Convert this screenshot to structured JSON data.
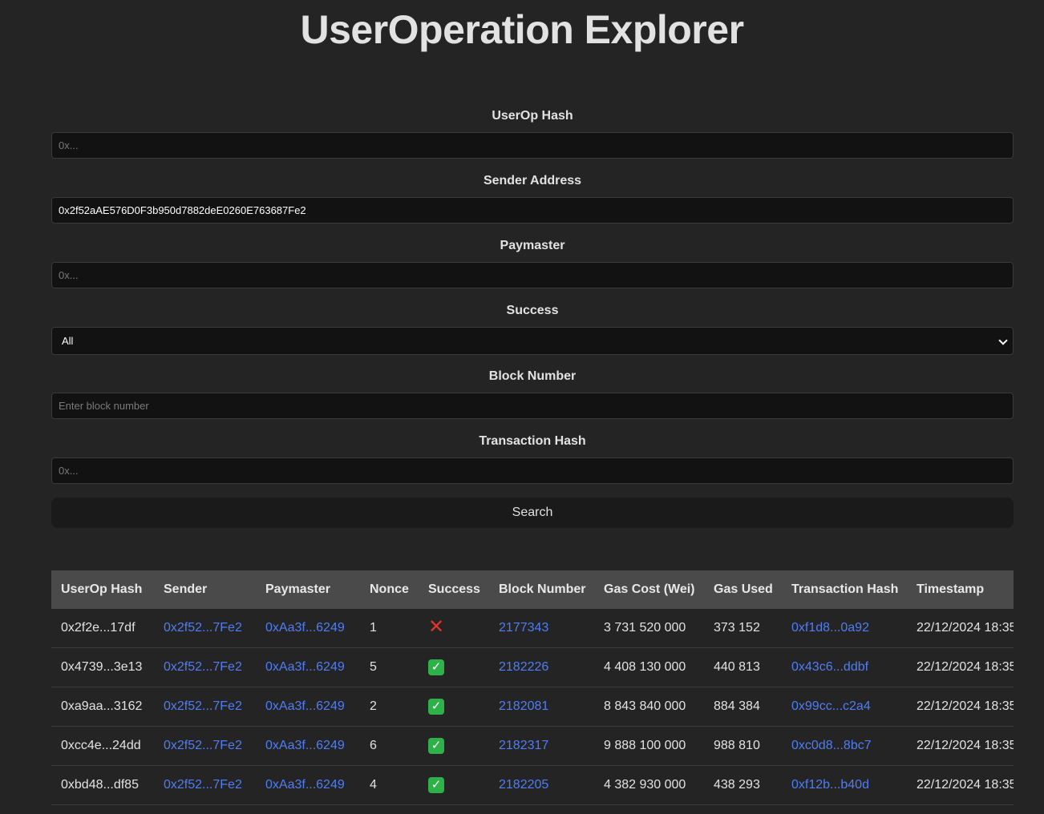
{
  "page": {
    "title": "UserOperation Explorer"
  },
  "form": {
    "userop_hash": {
      "label": "UserOp Hash",
      "placeholder": "0x...",
      "value": ""
    },
    "sender": {
      "label": "Sender Address",
      "placeholder": "0x...",
      "value": "0x2f52aAE576D0F3b950d7882deE0260E763687Fe2"
    },
    "paymaster": {
      "label": "Paymaster",
      "placeholder": "0x...",
      "value": ""
    },
    "success": {
      "label": "Success",
      "selected": "All"
    },
    "block_number": {
      "label": "Block Number",
      "placeholder": "Enter block number",
      "value": ""
    },
    "tx_hash": {
      "label": "Transaction Hash",
      "placeholder": "0x...",
      "value": ""
    },
    "search_label": "Search"
  },
  "table": {
    "headers": [
      "UserOp Hash",
      "Sender",
      "Paymaster",
      "Nonce",
      "Success",
      "Block Number",
      "Gas Cost (Wei)",
      "Gas Used",
      "Transaction Hash",
      "Timestamp"
    ],
    "rows": [
      {
        "hash": "0x2f2e...17df",
        "sender": "0x2f52...7Fe2",
        "paymaster": "0xAa3f...6249",
        "nonce": "1",
        "success": false,
        "success_icon": "cross-mark-icon",
        "block": "2177343",
        "gas_cost": "3 731 520 000",
        "gas_used": "373 152",
        "tx_hash": "0xf1d8...0a92",
        "timestamp": "22/12/2024 18:35"
      },
      {
        "hash": "0x4739...3e13",
        "sender": "0x2f52...7Fe2",
        "paymaster": "0xAa3f...6249",
        "nonce": "5",
        "success": true,
        "success_icon": "check-mark-icon",
        "block": "2182226",
        "gas_cost": "4 408 130 000",
        "gas_used": "440 813",
        "tx_hash": "0x43c6...ddbf",
        "timestamp": "22/12/2024 18:35"
      },
      {
        "hash": "0xa9aa...3162",
        "sender": "0x2f52...7Fe2",
        "paymaster": "0xAa3f...6249",
        "nonce": "2",
        "success": true,
        "success_icon": "check-mark-icon",
        "block": "2182081",
        "gas_cost": "8 843 840 000",
        "gas_used": "884 384",
        "tx_hash": "0x99cc...c2a4",
        "timestamp": "22/12/2024 18:35"
      },
      {
        "hash": "0xcc4e...24dd",
        "sender": "0x2f52...7Fe2",
        "paymaster": "0xAa3f...6249",
        "nonce": "6",
        "success": true,
        "success_icon": "check-mark-icon",
        "block": "2182317",
        "gas_cost": "9 888 100 000",
        "gas_used": "988 810",
        "tx_hash": "0xc0d8...8bc7",
        "timestamp": "22/12/2024 18:35"
      },
      {
        "hash": "0xbd48...df85",
        "sender": "0x2f52...7Fe2",
        "paymaster": "0xAa3f...6249",
        "nonce": "4",
        "success": true,
        "success_icon": "check-mark-icon",
        "block": "2182205",
        "gas_cost": "4 382 930 000",
        "gas_used": "438 293",
        "tx_hash": "0xf12b...b40d",
        "timestamp": "22/12/2024 18:35"
      }
    ]
  },
  "colors": {
    "background": "#242424",
    "input_background": "#121212",
    "header_background": "#4a4a4a",
    "link": "#4f7df5",
    "success": "#2fb14a",
    "failure": "#e5322b"
  }
}
